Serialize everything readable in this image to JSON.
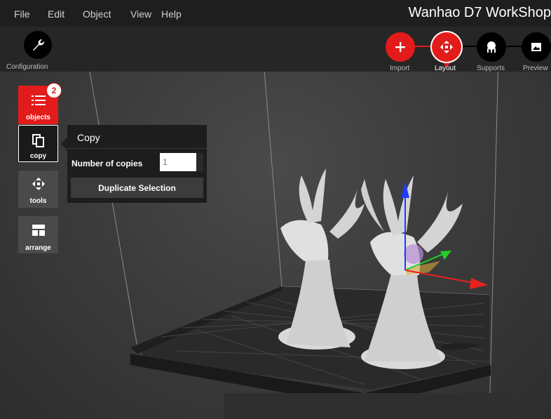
{
  "menu": {
    "items": [
      {
        "label": "File"
      },
      {
        "label": "Edit"
      },
      {
        "label": "Object"
      },
      {
        "label": "View"
      },
      {
        "label": "Help"
      }
    ]
  },
  "app_title": "Wanhao D7 WorkShop",
  "toolbar": {
    "configuration_label": "Configuration",
    "steps": [
      {
        "label": "Import",
        "icon": "plus-icon",
        "color": "#e31b1b"
      },
      {
        "label": "Layout",
        "icon": "move-arrows-icon",
        "color": "#e31b1b"
      },
      {
        "label": "Supports",
        "icon": "supports-icon",
        "color": "#000000"
      },
      {
        "label": "Preview",
        "icon": "image-icon",
        "color": "#000000"
      }
    ],
    "active_step": "Layout"
  },
  "side_panel": {
    "objects_label": "objects",
    "objects_count": "2",
    "copy_label": "copy",
    "tools_label": "tools",
    "arrange_label": "arrange"
  },
  "copy_panel": {
    "title": "Copy",
    "copies_label": "Number of copies",
    "copies_value": "1",
    "duplicate_label": "Duplicate Selection"
  },
  "colors": {
    "accent": "#e31b1b",
    "panel": "#1d1d1d",
    "axis_x": "#e8221f",
    "axis_y": "#22d12a",
    "axis_z": "#1f3bff"
  }
}
